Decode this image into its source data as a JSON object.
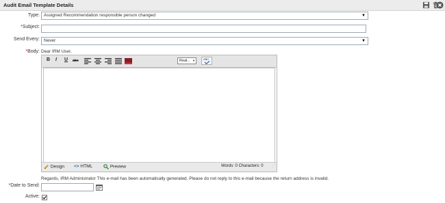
{
  "header": {
    "title": "Audit Email Template Details",
    "save_icon": "save-icon",
    "delete_icon": "trash-icon",
    "close_icon": "close-circle-icon"
  },
  "form": {
    "type_label": "Type:",
    "type_value": "Assigned Recommendation responsible person changed",
    "subject_label": "Subject:",
    "subject_value": "",
    "send_every_label": "Send Every:",
    "send_every_value": "Never",
    "body_label": "Body:",
    "body_intro": "Dear IRM User,",
    "body_footer": "Regards, IRM Administrator This e-mail has been automatically generated. Please do not reply to this e-mail because the return address is invalid.",
    "date_label": "Date to Send:",
    "date_value": "",
    "active_label": "Active:",
    "active_checked": true,
    "required_mark": "*"
  },
  "editor": {
    "toolbar": {
      "bold": "B",
      "italic": "I",
      "underline": "U",
      "strike": "abc",
      "font_select": "Real...",
      "spell": "ABC"
    },
    "modes": {
      "design": "Design",
      "html": "HTML",
      "preview": "Preview"
    },
    "stats": "Words: 0   Characters: 0"
  },
  "colors": {
    "titlebar": "#ececec",
    "required": "#dd0000",
    "icon_gray": "#555555"
  }
}
